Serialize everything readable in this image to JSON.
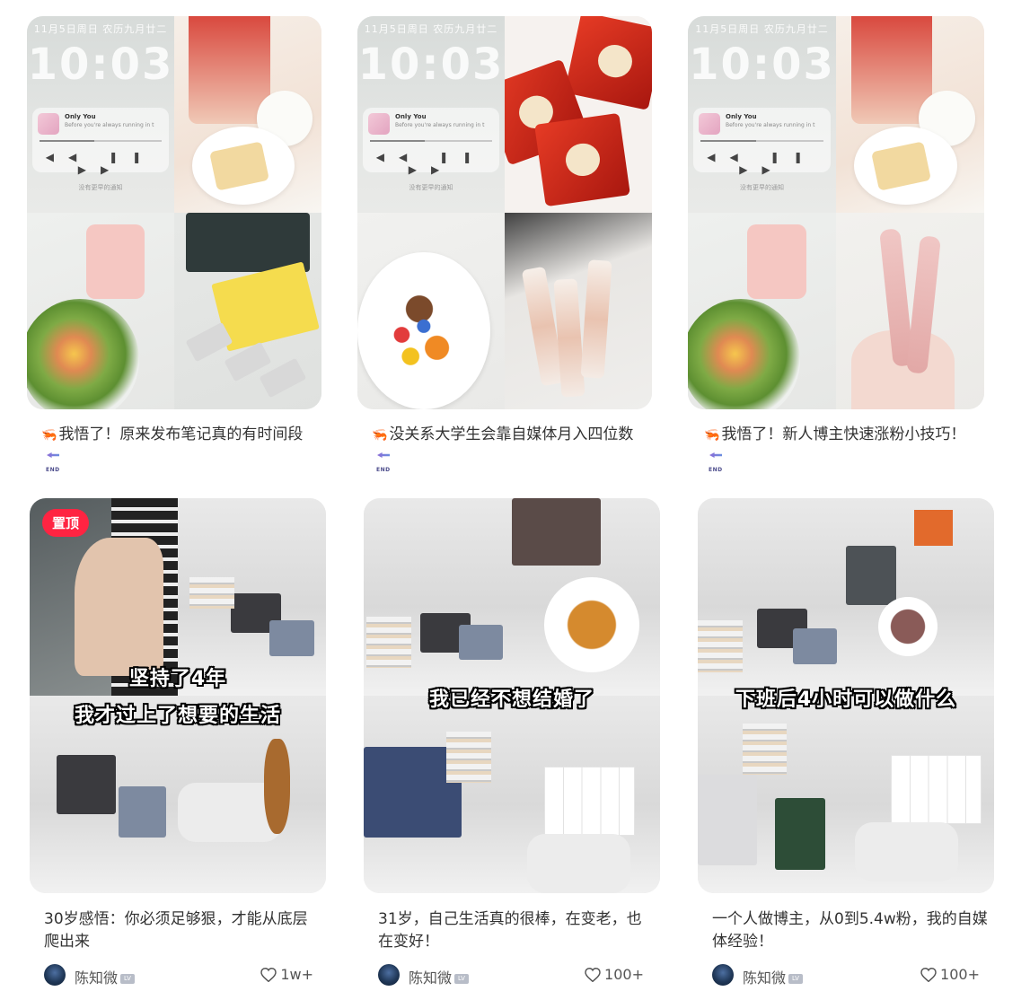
{
  "feed": {
    "row1": [
      {
        "title": "我悟了！原来发布笔记真的有时间段",
        "lock": {
          "date": "11月5日周日 农历九月廿二",
          "time": "10:03",
          "song": "Only You",
          "lyric": "Before you're always running in t",
          "notify": "没有更早的通知"
        }
      },
      {
        "title": "没关系大学生会靠自媒体月入四位数",
        "lock": {
          "date": "11月5日周日 农历九月廿二",
          "time": "10:03",
          "song": "Only You",
          "lyric": "Before you're always running in t",
          "notify": "没有更早的通知"
        }
      },
      {
        "title": "我悟了！新人博主快速涨粉小技巧！",
        "lock": {
          "date": "11月5日周日 农历九月廿二",
          "time": "10:03",
          "song": "Only You",
          "lyric": "Before you're always running in t",
          "notify": "没有更早的通知"
        }
      }
    ],
    "row2": [
      {
        "title": "30岁感悟：你必须足够狠，才能从底层爬出来",
        "overlay_line1": "坚持了4年",
        "overlay_line2": "我才过上了想要的生活",
        "pin_label": "置顶",
        "author": "陈知微",
        "likes": "1w+"
      },
      {
        "title": "31岁，自己生活真的很棒，在变老，也在变好！",
        "overlay_line1": "我已经不想结婚了",
        "author": "陈知微",
        "likes": "100+"
      },
      {
        "title": "一个人做博主，从0到5.4w粉，我的自媒体经验！",
        "overlay_line1": "下班后4小时可以做什么",
        "author": "陈知微",
        "likes": "100+"
      }
    ],
    "end_tag": "END",
    "level_badge": "LV"
  },
  "icons": {
    "shrimp": "shrimp-emoji-icon",
    "end_arrow": "end-arrow-icon",
    "heart": "heart-icon",
    "avatar": "avatar"
  },
  "colors": {
    "pin_bg": "#ff2442",
    "shrimp": "#ff4b2b",
    "text": "#333333"
  }
}
